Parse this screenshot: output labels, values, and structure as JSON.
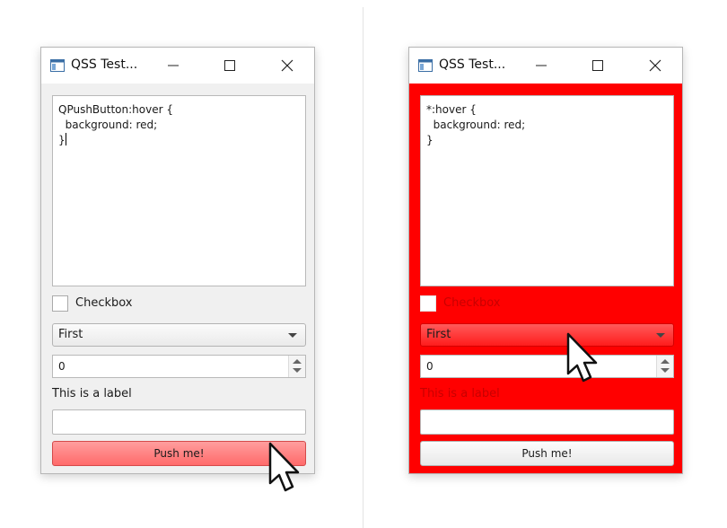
{
  "windows": [
    {
      "title": "QSS Test...",
      "editor_lines": [
        "QPushButton:hover {",
        "  background: red;",
        "}"
      ],
      "checkbox_label": "Checkbox",
      "combo_value": "First",
      "spin_value": "0",
      "label_text": "This is a label",
      "lineedit_value": "",
      "button_label": "Push me!"
    },
    {
      "title": "QSS Test...",
      "editor_lines": [
        "*:hover {",
        "  background: red;",
        "}"
      ],
      "checkbox_label": "Checkbox",
      "combo_value": "First",
      "spin_value": "0",
      "label_text": "This is a label",
      "lineedit_value": "",
      "button_label": "Push me!"
    }
  ],
  "icons": {
    "app": "app-window-icon",
    "minimize": "minimize-icon",
    "maximize": "maximize-icon",
    "close": "close-icon",
    "pointer": "mouse-pointer-icon"
  },
  "colors": {
    "hover_red": "#ff0000",
    "button_hover": "#ff7777"
  }
}
